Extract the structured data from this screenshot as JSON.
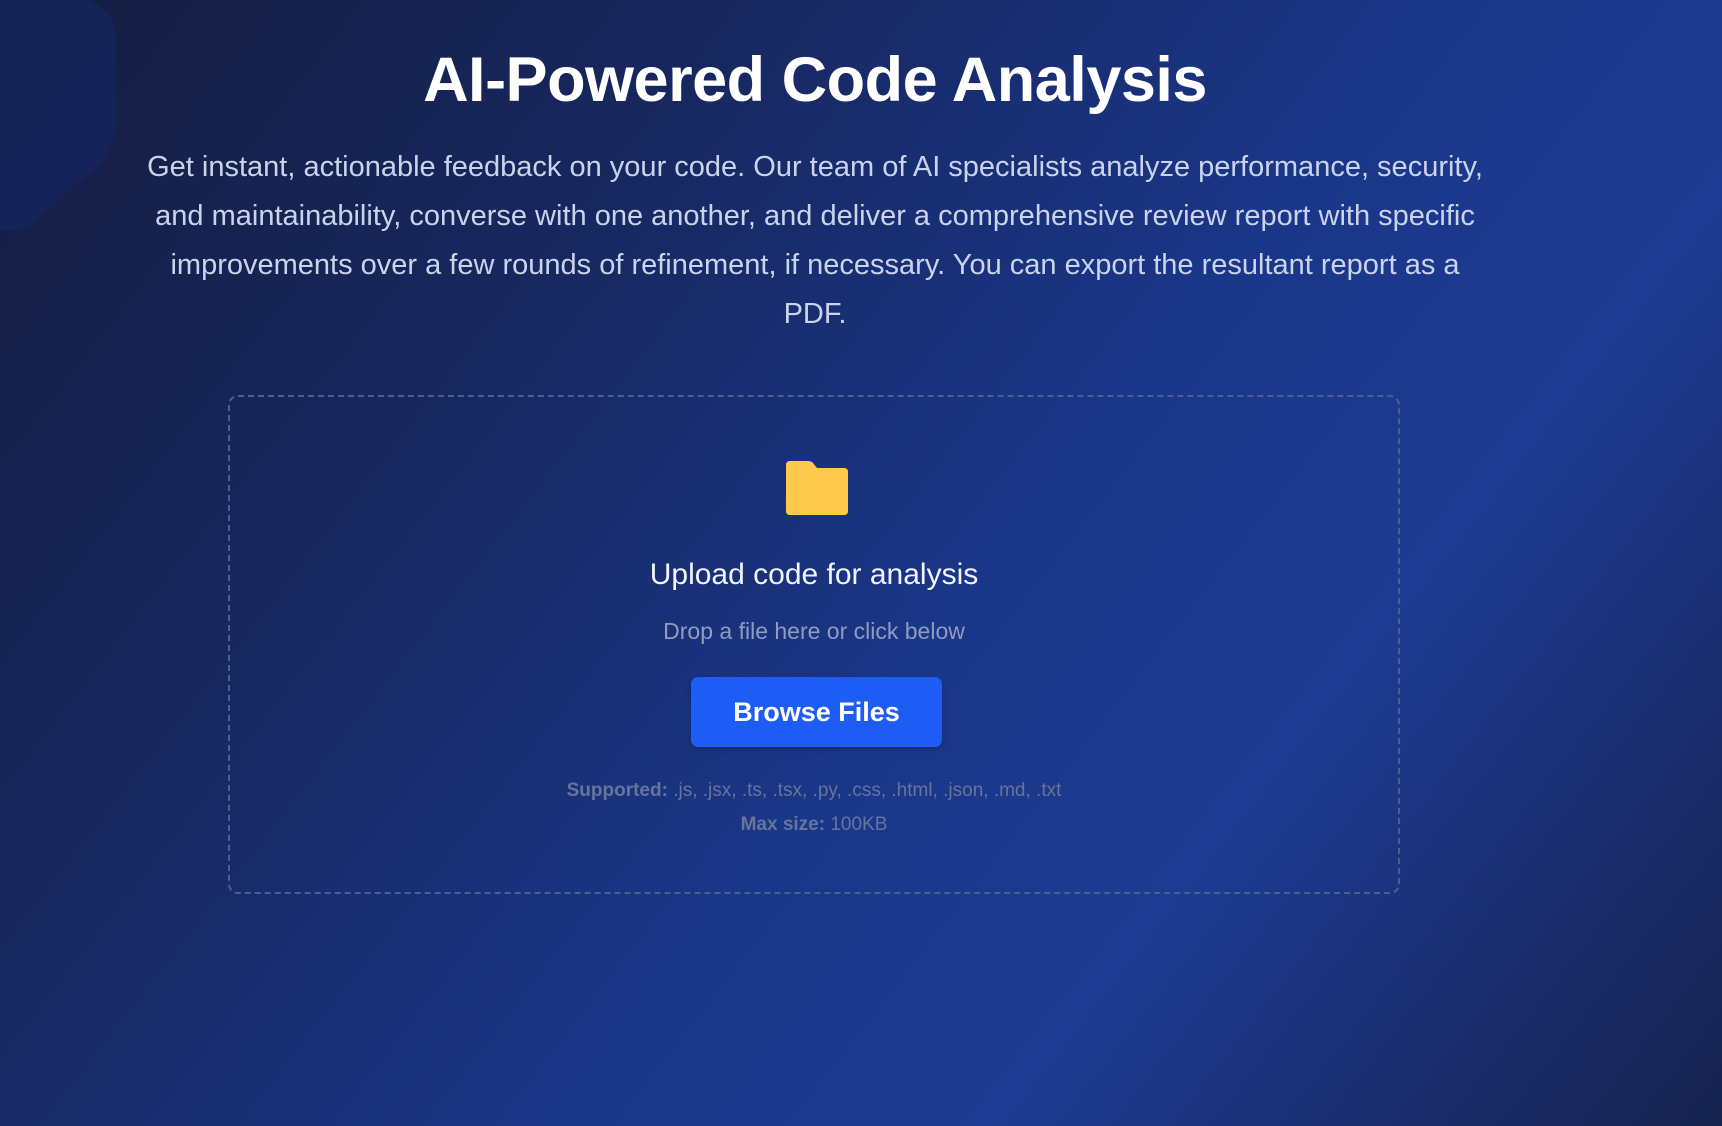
{
  "hero": {
    "title": "AI-Powered Code Analysis",
    "description": "Get instant, actionable feedback on your code. Our team of AI specialists analyze performance, security, and maintainability, converse with one another, and deliver a comprehensive review report with specific improvements over a few rounds of refinement, if necessary. You can export the resultant report as a PDF."
  },
  "upload": {
    "icon": "folder-icon",
    "icon_color": "#ffc94d",
    "title": "Upload code for analysis",
    "hint": "Drop a file here or click below",
    "button_label": "Browse Files",
    "supported_label": "Supported:",
    "supported_value": " .js, .jsx, .ts, .tsx, .py, .css, .html, .json, .md, .txt",
    "max_size_label": "Max size:",
    "max_size_value": " 100KB"
  },
  "colors": {
    "accent": "#1d5cf5",
    "background_dark": "#151d3f",
    "background_mid": "#1a3688"
  }
}
